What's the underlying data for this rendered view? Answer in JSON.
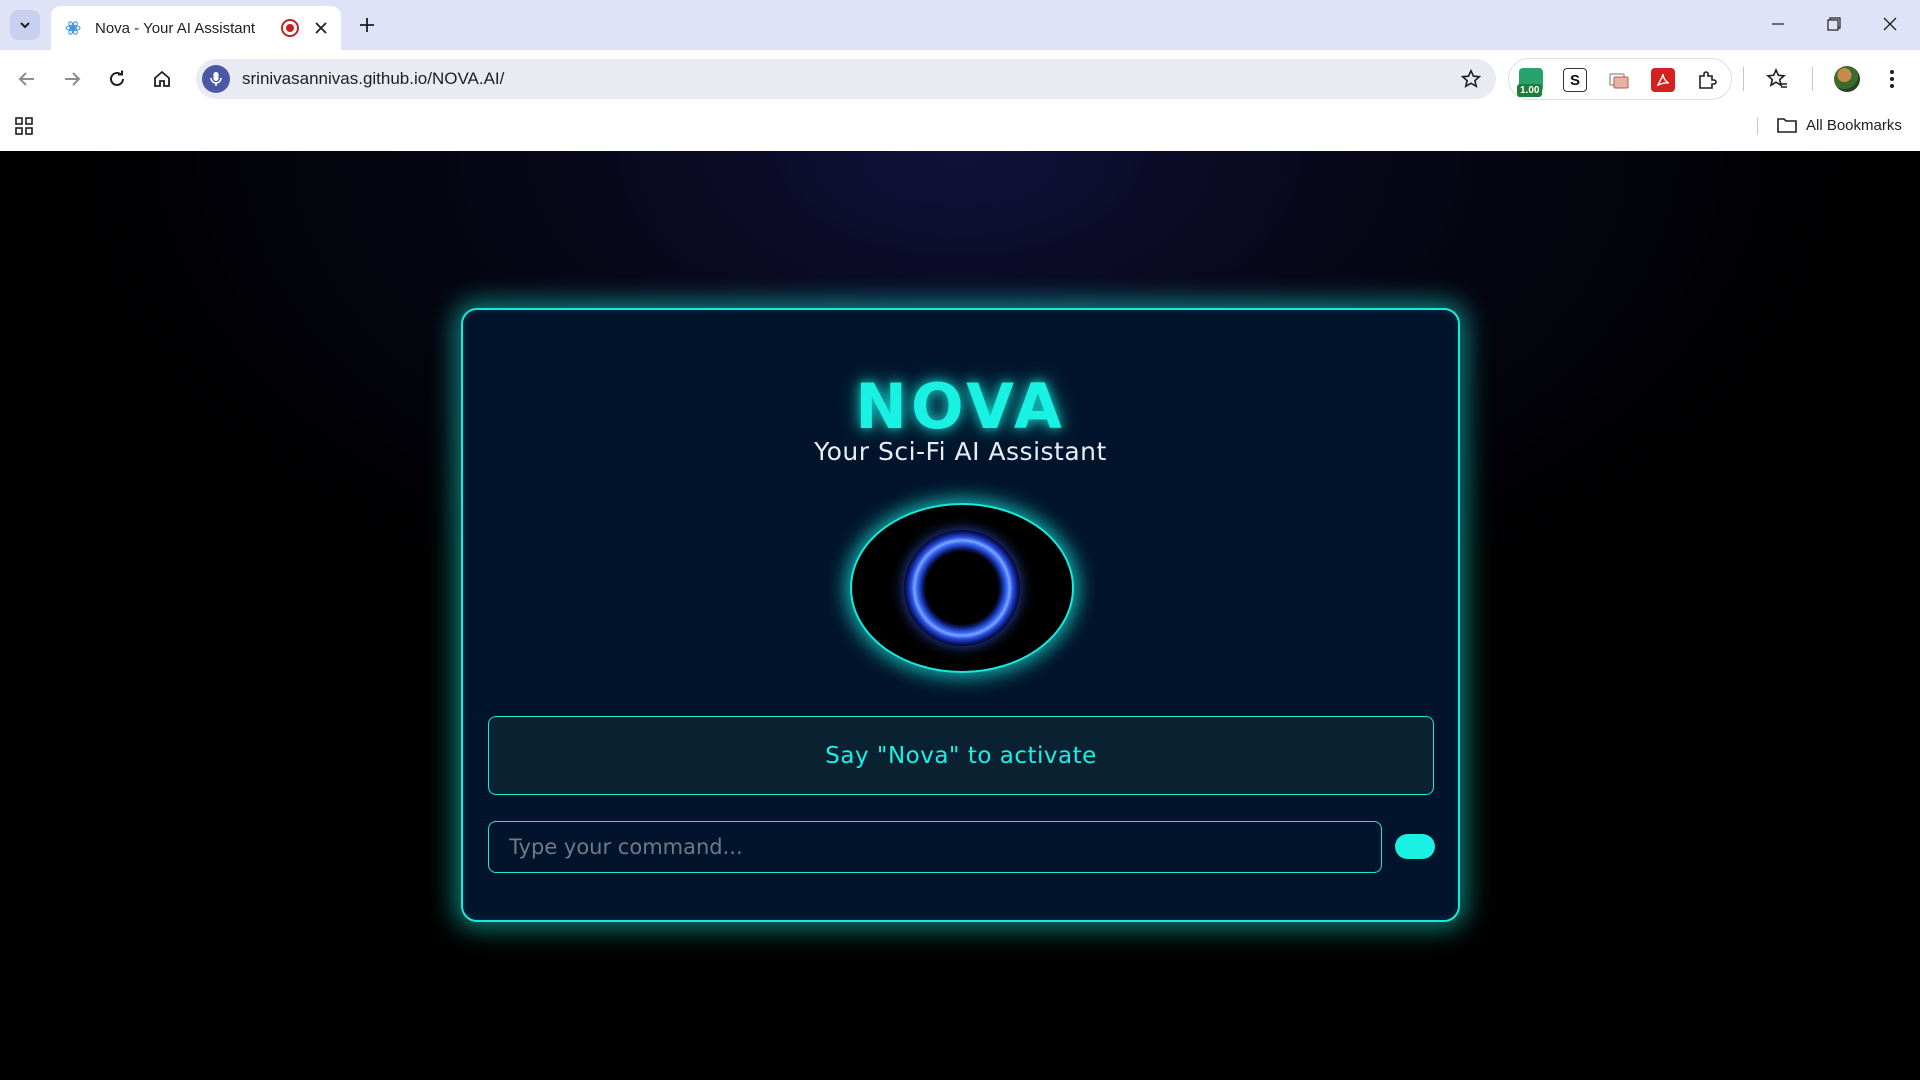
{
  "browser": {
    "tab_title": "Nova - Your AI Assistant",
    "url": "srinivasannivas.github.io/NOVA.AI/",
    "extension_badge": "1.00",
    "bookmarks_label": "All Bookmarks"
  },
  "app": {
    "title": "NOVA",
    "subtitle": "Your Sci-Fi AI Assistant",
    "status_text": "Say \"Nova\" to activate",
    "input_placeholder": "Type your command...",
    "input_value": ""
  },
  "colors": {
    "accent": "#19f1e2",
    "card_bg": "#02142b",
    "page_bg": "#000000",
    "orb_ring": "#3a6cff"
  },
  "icons": [
    "tab-search-icon",
    "favicon-icon",
    "recording-icon",
    "close-icon",
    "plus-icon",
    "minimize-icon",
    "restore-icon",
    "window-close-icon",
    "back-icon",
    "forward-icon",
    "reload-icon",
    "home-icon",
    "mic-icon",
    "bookmark-star-icon",
    "extensions-icon",
    "apps-icon",
    "folder-icon"
  ]
}
